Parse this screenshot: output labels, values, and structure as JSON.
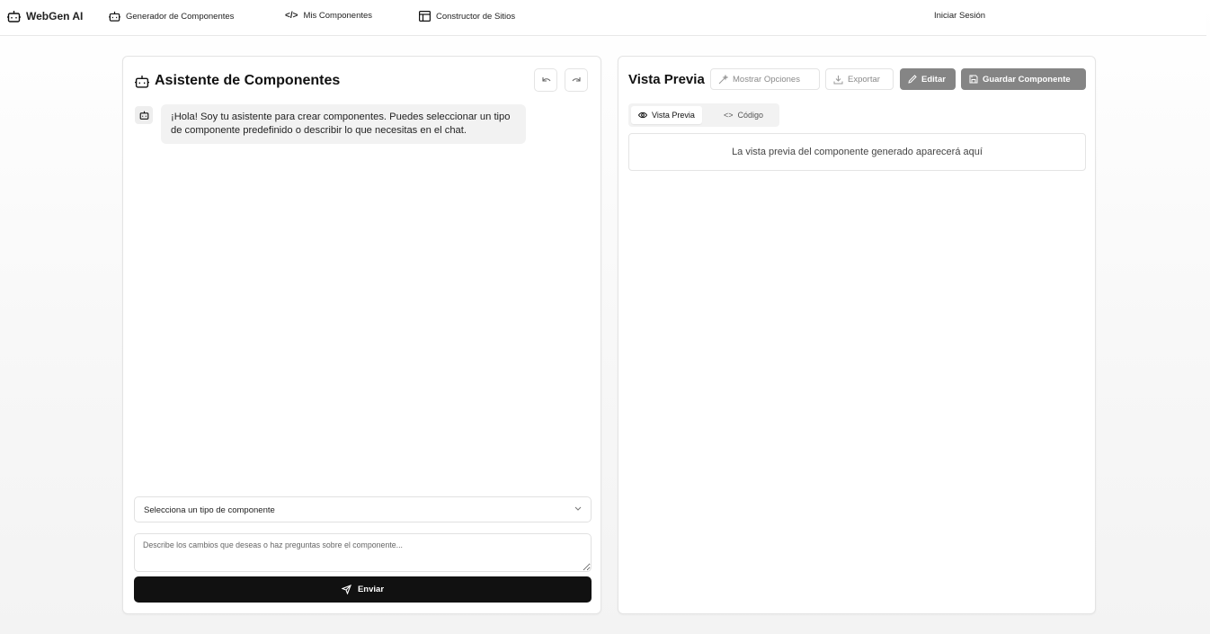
{
  "nav": {
    "brand": "WebGen AI",
    "items": [
      {
        "label": "Generador de Componentes",
        "icon": "robot-icon"
      },
      {
        "label": "Mis Componentes",
        "icon": "code-icon"
      },
      {
        "label": "Constructor de Sitios",
        "icon": "layout-icon"
      }
    ],
    "login": "Iniciar Sesión"
  },
  "assistant": {
    "title": "Asistente de Componentes",
    "welcome": "¡Hola! Soy tu asistente para crear componentes. Puedes seleccionar un tipo de componente predefinido o describir lo que necesitas en el chat.",
    "select_placeholder": "Selecciona un tipo de componente",
    "input_placeholder": "Describe los cambios que deseas o haz preguntas sobre el componente...",
    "send_label": "Enviar"
  },
  "preview": {
    "title": "Vista Previa",
    "show_options": "Mostrar Opciones",
    "export": "Exportar",
    "edit": "Editar",
    "save": "Guardar Componente",
    "tabs": [
      "Vista Previa",
      "Código"
    ],
    "placeholder": "La vista previa del componente generado aparecerá aquí"
  }
}
